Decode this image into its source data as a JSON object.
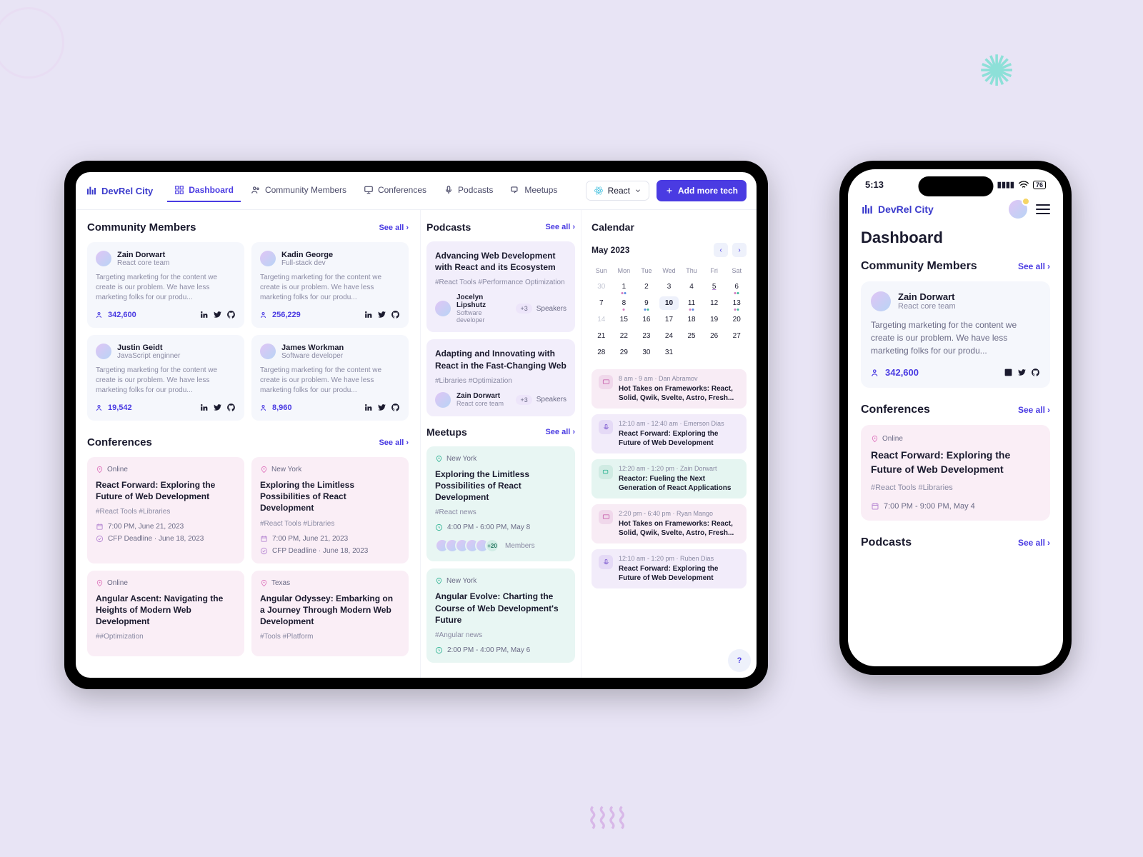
{
  "app": {
    "name": "DevRel City"
  },
  "nav": {
    "items": [
      {
        "label": "Dashboard"
      },
      {
        "label": "Community Members"
      },
      {
        "label": "Conferences"
      },
      {
        "label": "Podcasts"
      },
      {
        "label": "Meetups"
      }
    ],
    "tech_filter": "React",
    "add_button": "Add more tech"
  },
  "see_all": "See all",
  "sections": {
    "members_title": "Community Members",
    "conferences_title": "Conferences",
    "podcasts_title": "Podcasts",
    "meetups_title": "Meetups",
    "calendar_title": "Calendar"
  },
  "members": [
    {
      "name": "Zain Dorwart",
      "role": "React core team",
      "desc": "Targeting marketing for the content we create is our problem. We have less marketing folks for our produ...",
      "count": "342,600"
    },
    {
      "name": "Kadin George",
      "role": "Full-stack dev",
      "desc": "Targeting marketing for the content we create is our problem. We have less marketing folks for our produ...",
      "count": "256,229"
    },
    {
      "name": "Justin Geidt",
      "role": "JavaScript enginner",
      "desc": "Targeting marketing for the content we create is our problem. We have less marketing folks for our produ...",
      "count": "19,542"
    },
    {
      "name": "James Workman",
      "role": "Software developer",
      "desc": "Targeting marketing for the content we create is our problem. We have less marketing folks for our produ...",
      "count": "8,960"
    }
  ],
  "conferences": [
    {
      "location": "Online",
      "title": "React Forward: Exploring the Future of Web Development",
      "tags": "#React Tools   #Libraries",
      "time": "7:00 PM, June 21, 2023",
      "cfp": "CFP Deadline · June 18, 2023"
    },
    {
      "location": "New York",
      "title": "Exploring the Limitless Possibilities of React Development",
      "tags": "#React Tools   #Libraries",
      "time": "7:00 PM, June 21, 2023",
      "cfp": "CFP Deadline · June 18, 2023"
    },
    {
      "location": "Online",
      "title": "Angular Ascent: Navigating the Heights of Modern Web Development",
      "tags": "##Optimization",
      "time": "",
      "cfp": ""
    },
    {
      "location": "Texas",
      "title": "Angular Odyssey: Embarking on a Journey Through Modern Web Development",
      "tags": "#Tools   #Platform",
      "time": "",
      "cfp": ""
    }
  ],
  "podcasts": [
    {
      "title": "Advancing Web Development with React and its Ecosystem",
      "tags": "#React Tools   #Performance Optimization",
      "speaker": "Jocelyn Lipshutz",
      "role": "Software developer",
      "extra": "+3",
      "extra_label": "Speakers"
    },
    {
      "title": "Adapting and Innovating with React in the Fast-Changing Web",
      "tags": "#Libraries   #Optimization",
      "speaker": "Zain Dorwart",
      "role": "React core team",
      "extra": "+3",
      "extra_label": "Speakers"
    }
  ],
  "meetups": [
    {
      "location": "New York",
      "title": "Exploring the Limitless Possibilities of React Development",
      "tags": "#React news",
      "time": "4:00 PM - 6:00 PM, May 8",
      "more": "+20",
      "more_label": "Members"
    },
    {
      "location": "New York",
      "title": "Angular Evolve: Charting the Course of Web Development's Future",
      "tags": "#Angular news",
      "time": "2:00 PM - 4:00 PM, May 6",
      "more": "",
      "more_label": ""
    }
  ],
  "calendar": {
    "month": "May 2023",
    "dow": [
      "Sun",
      "Mon",
      "Tue",
      "Wed",
      "Thu",
      "Fri",
      "Sat"
    ],
    "days": [
      {
        "n": "30",
        "state": "muted"
      },
      {
        "n": "1",
        "dots": [
          "p",
          "b"
        ]
      },
      {
        "n": "2"
      },
      {
        "n": "3"
      },
      {
        "n": "4"
      },
      {
        "n": "5",
        "state": "underline"
      },
      {
        "n": "6",
        "dots": [
          "p",
          "g"
        ]
      },
      {
        "n": "7"
      },
      {
        "n": "8",
        "dots": [
          "p"
        ]
      },
      {
        "n": "9",
        "dots": [
          "b",
          "g"
        ]
      },
      {
        "n": "10",
        "state": "today"
      },
      {
        "n": "11",
        "dots": [
          "p",
          "b"
        ]
      },
      {
        "n": "12"
      },
      {
        "n": "13",
        "dots": [
          "p",
          "g"
        ]
      },
      {
        "n": "14",
        "state": "muted"
      },
      {
        "n": "15"
      },
      {
        "n": "16"
      },
      {
        "n": "17"
      },
      {
        "n": "18"
      },
      {
        "n": "19"
      },
      {
        "n": "20"
      },
      {
        "n": "21"
      },
      {
        "n": "22"
      },
      {
        "n": "23"
      },
      {
        "n": "24"
      },
      {
        "n": "25"
      },
      {
        "n": "26"
      },
      {
        "n": "27"
      },
      {
        "n": "28"
      },
      {
        "n": "29"
      },
      {
        "n": "30"
      },
      {
        "n": "31"
      },
      {
        "n": "",
        "state": "empty"
      },
      {
        "n": "",
        "state": "empty"
      },
      {
        "n": "",
        "state": "empty"
      }
    ],
    "events": [
      {
        "kind": "pink",
        "meta": "8 am - 9 am · Dan Abramov",
        "title": "Hot Takes on Frameworks: React, Solid, Qwik, Svelte, Astro, Fresh..."
      },
      {
        "kind": "purple",
        "meta": "12:10 am - 12:40 am · Emerson Dias",
        "title": "React Forward: Exploring the Future of Web Development"
      },
      {
        "kind": "teal",
        "meta": "12:20 am - 1:20 pm · Zain Dorwart",
        "title": "Reactor: Fueling the Next Generation of React Applications"
      },
      {
        "kind": "pink",
        "meta": "2:20 pm - 6:40 pm · Ryan Mango",
        "title": "Hot Takes on Frameworks: React, Solid, Qwik, Svelte, Astro, Fresh..."
      },
      {
        "kind": "purple",
        "meta": "12:10 am - 1:20 pm · Ruben Dias",
        "title": "React Forward: Exploring the Future of Web Development"
      }
    ]
  },
  "phone": {
    "time": "5:13",
    "battery": "76",
    "title": "Dashboard",
    "member": {
      "name": "Zain Dorwart",
      "role": "React core team",
      "desc": "Targeting marketing for the content we create is our problem. We have less marketing folks for our produ...",
      "count": "342,600"
    },
    "conference": {
      "location": "Online",
      "title": "React Forward: Exploring the Future of Web Development",
      "tags": "#React Tools   #Libraries",
      "time": "7:00 PM - 9:00 PM, May 4"
    }
  }
}
